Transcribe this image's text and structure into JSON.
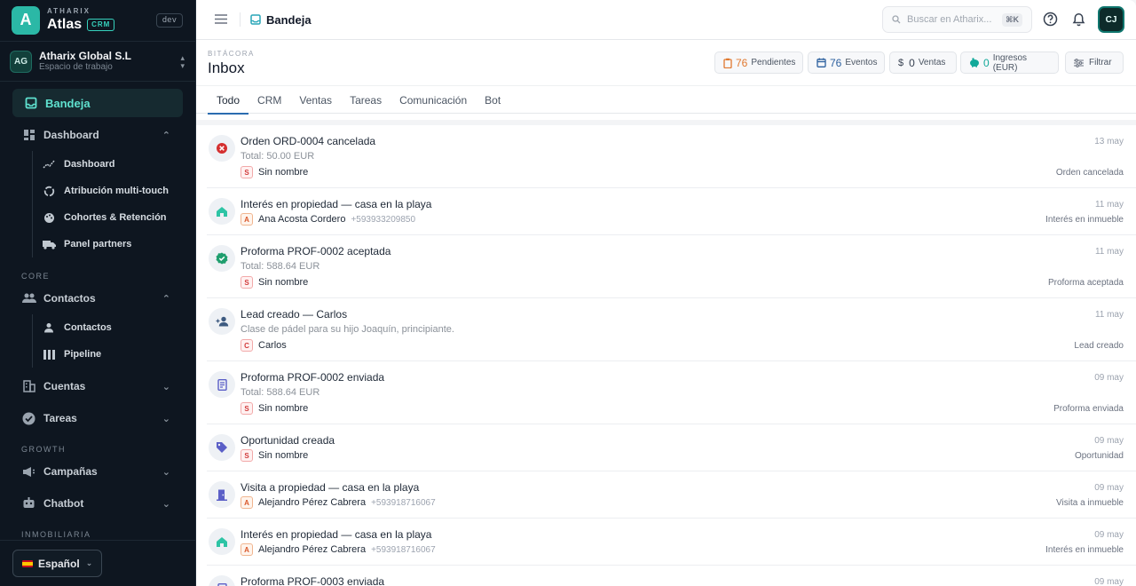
{
  "brand": {
    "company": "ATHARIX",
    "app": "Atlas",
    "badge": "CRM",
    "env": "dev",
    "logo_letter": "A"
  },
  "workspace": {
    "initials": "AG",
    "name": "Atharix Global S.L",
    "subtitle": "Espacio de trabajo"
  },
  "sidebar": {
    "active": "Bandeja",
    "dashboard": {
      "label": "Dashboard",
      "items": [
        "Dashboard",
        "Atribución multi-touch",
        "Cohortes & Retención",
        "Panel partners"
      ]
    },
    "core_label": "CORE",
    "contactos": {
      "label": "Contactos",
      "items": [
        "Contactos",
        "Pipeline"
      ]
    },
    "cuentas": "Cuentas",
    "tareas": "Tareas",
    "growth_label": "GROWTH",
    "campanas": "Campañas",
    "chatbot": "Chatbot",
    "inmobiliaria_label": "INMOBILIARIA",
    "language": "Español"
  },
  "topbar": {
    "breadcrumb": "Bandeja",
    "search_placeholder": "Buscar en Atharix...",
    "search_shortcut": "⌘K",
    "user_initials": "CJ"
  },
  "page": {
    "kicker": "BITÁCORA",
    "title": "Inbox"
  },
  "stats": [
    {
      "value": "76",
      "label": "Pendientes",
      "color": "#e0782f"
    },
    {
      "value": "76",
      "label": "Eventos",
      "color": "#2b5f9e"
    },
    {
      "value": "0",
      "label": "Ventas",
      "color": "#374151",
      "prefix": "$"
    },
    {
      "value": "0",
      "label": "Ingresos (EUR)",
      "color": "#12a99a"
    }
  ],
  "filter_label": "Filtrar",
  "tabs": [
    "Todo",
    "CRM",
    "Ventas",
    "Tareas",
    "Comunicación",
    "Bot"
  ],
  "active_tab": "Todo",
  "feed": [
    {
      "title": "Orden ORD-0004 cancelada",
      "sub": "Total: 50.00 EUR",
      "badge": "S",
      "person": "Sin nombre",
      "phone": "",
      "date": "13 may",
      "type": "Orden cancelada",
      "icon": "cancel-icon"
    },
    {
      "title": "Interés en propiedad — casa en la playa",
      "sub": "",
      "badge": "A",
      "person": "Ana Acosta Cordero",
      "phone": "+593933209850",
      "date": "11 may",
      "type": "Interés en inmueble",
      "icon": "house-icon"
    },
    {
      "title": "Proforma PROF-0002 aceptada",
      "sub": "Total: 588.64 EUR",
      "badge": "S",
      "person": "Sin nombre",
      "phone": "",
      "date": "11 may",
      "type": "Proforma aceptada",
      "icon": "verified-icon"
    },
    {
      "title": "Lead creado — Carlos",
      "sub": "Clase de pádel para su hijo Joaquín, principiante.",
      "badge": "C",
      "person": "Carlos",
      "phone": "",
      "date": "11 may",
      "type": "Lead creado",
      "icon": "person-add-icon"
    },
    {
      "title": "Proforma PROF-0002 enviada",
      "sub": "Total: 588.64 EUR",
      "badge": "S",
      "person": "Sin nombre",
      "phone": "",
      "date": "09 may",
      "type": "Proforma enviada",
      "icon": "document-icon"
    },
    {
      "title": "Oportunidad creada",
      "sub": "",
      "badge": "S",
      "person": "Sin nombre",
      "phone": "",
      "date": "09 may",
      "type": "Oportunidad",
      "icon": "tag-icon"
    },
    {
      "title": "Visita a propiedad — casa en la playa",
      "sub": "",
      "badge": "A",
      "person": "Alejandro Pérez Cabrera",
      "phone": "+593918716067",
      "date": "09 may",
      "type": "Visita a inmueble",
      "icon": "door-icon"
    },
    {
      "title": "Interés en propiedad — casa en la playa",
      "sub": "",
      "badge": "A",
      "person": "Alejandro Pérez Cabrera",
      "phone": "+593918716067",
      "date": "09 may",
      "type": "Interés en inmueble",
      "icon": "house-icon"
    },
    {
      "title": "Proforma PROF-0003 enviada",
      "sub": "",
      "badge": "",
      "person": "",
      "phone": "",
      "date": "09 may",
      "type": "",
      "icon": "document-icon"
    }
  ]
}
